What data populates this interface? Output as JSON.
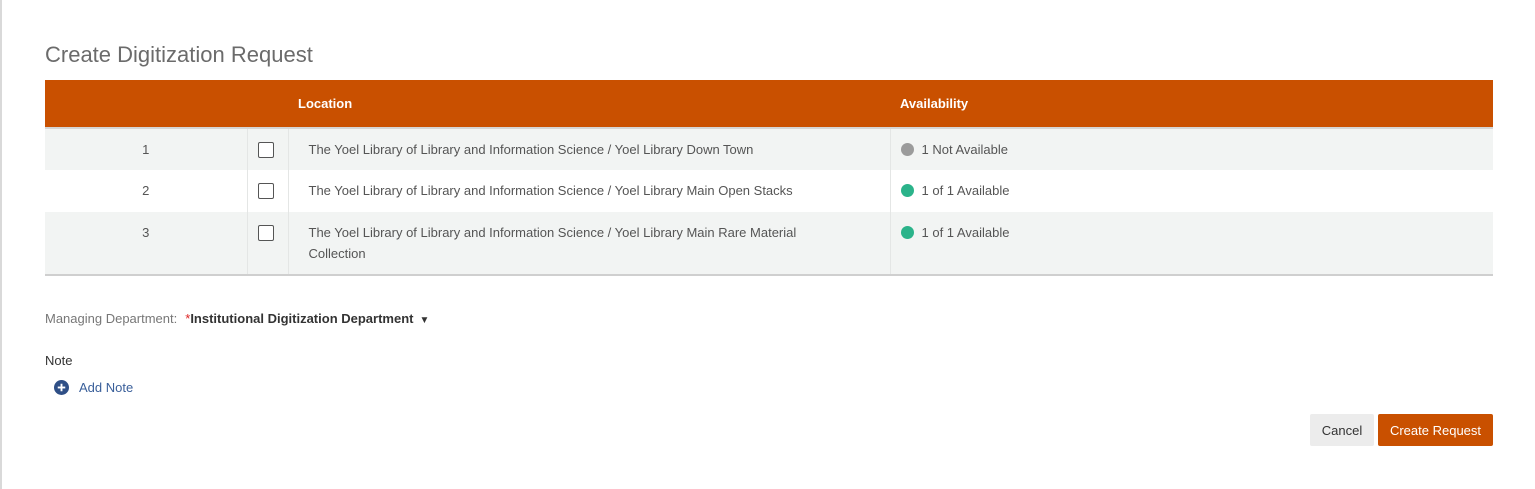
{
  "dialog": {
    "title": "Create Digitization Request"
  },
  "table": {
    "headers": {
      "index": "",
      "select": "",
      "location": "Location",
      "availability": "Availability"
    },
    "rows": [
      {
        "index": "1",
        "location": "The Yoel Library of Library and Information Science / Yoel Library Down Town",
        "availability": "1 Not Available",
        "status_color": "#9b9b9b"
      },
      {
        "index": "2",
        "location": "The Yoel Library of Library and Information Science / Yoel Library Main Open Stacks",
        "availability": "1 of 1 Available",
        "status_color": "#2bb38a"
      },
      {
        "index": "3",
        "location": "The Yoel Library of Library and Information Science / Yoel Library Main Rare Material Collection",
        "availability": "1 of 1 Available",
        "status_color": "#2bb38a"
      }
    ]
  },
  "form": {
    "managing_department_label": "Managing Department:",
    "required_marker": "*",
    "managing_department_value": "Institutional Digitization Department",
    "note_label": "Note",
    "add_note_label": "Add Note",
    "add_note_icon": "plus-circle-icon",
    "dropdown_icon": "caret-down-icon"
  },
  "actions": {
    "cancel_label": "Cancel",
    "create_label": "Create Request"
  },
  "colors": {
    "accent": "#c95000",
    "link": "#3a5f9a",
    "available": "#2bb38a",
    "not_available": "#9b9b9b"
  }
}
